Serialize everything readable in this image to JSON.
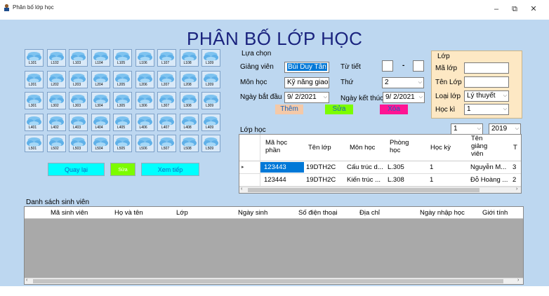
{
  "window": {
    "title": "Phân bố lớp học",
    "minimize": "–",
    "maximize": "⧉",
    "close": "✕"
  },
  "heading": "PHÂN BỐ LỚP HỌC",
  "rooms": [
    "L101",
    "L102",
    "L103",
    "L104",
    "L105",
    "L106",
    "L107",
    "L108",
    "L109",
    "L201",
    "L202",
    "L203",
    "L204",
    "L205",
    "L206",
    "L207",
    "L208",
    "L209",
    "L301",
    "L302",
    "L303",
    "L304",
    "L305",
    "L306",
    "L307",
    "L308",
    "L309",
    "L401",
    "L402",
    "L403",
    "L404",
    "L405",
    "L406",
    "L407",
    "L408",
    "L409",
    "L501",
    "L502",
    "L503",
    "L504",
    "L505",
    "L506",
    "L507",
    "L508",
    "L509"
  ],
  "buttons": {
    "back": "Quay lại",
    "edit_small": "Sửa",
    "next": "Xem tiếp"
  },
  "selection": {
    "title": "Lựa chọn",
    "teacher_label": "Giảng viên",
    "teacher_value": "Bùi Duy Tân",
    "period_label": "Từ tiết",
    "period_from": "",
    "period_dash": "-",
    "period_to": "",
    "subject_label": "Môn học",
    "subject_value": "Kỹ năng giao",
    "day_label": "Thứ",
    "day_value": "2",
    "start_label": "Ngày bắt đầu",
    "start_value": "9/ 2/2021",
    "end_label": "Ngày kết thúc",
    "end_value": "9/ 2/2021",
    "add": "Thêm",
    "edit": "Sửa",
    "delete": "Xóa"
  },
  "class_panel": {
    "title": "Lớp",
    "code_label": "Mã lớp",
    "code_value": "",
    "name_label": "Tên Lớp",
    "name_value": "",
    "type_label": "Loại lớp",
    "type_value": "Lý thuyết",
    "term_label": "Học kì",
    "term_value": "1"
  },
  "class_list": {
    "title": "Lớp học",
    "filter_term": "1",
    "filter_year": "2019",
    "columns": [
      "Mã học phần",
      "Tên lớp",
      "Môn học",
      "Phòng học",
      "Học kỳ",
      "Tên giảng viên",
      "T"
    ],
    "rows": [
      [
        "123443",
        "19DTH2C",
        "Cấu trúc d...",
        "L.305",
        "1",
        "Nguyễn M...",
        "3"
      ],
      [
        "123444",
        "19DTH2C",
        "Kiến trúc ...",
        "L.308",
        "1",
        "Đỗ Hoàng ...",
        "2"
      ]
    ]
  },
  "students": {
    "title": "Danh sách sinh viên",
    "columns": [
      "Mã sinh viên",
      "Họ và tên",
      "Lớp",
      "Ngày sinh",
      "Số điện thoại",
      "Địa chỉ",
      "Ngày nhập học",
      "Giới tính"
    ]
  },
  "colors": {
    "form_bg": "#bdd7f0",
    "heading": "#1a237e",
    "selected": "#0078d7",
    "panel": "#fde8c4",
    "grid_empty": "#a9a9a9"
  }
}
